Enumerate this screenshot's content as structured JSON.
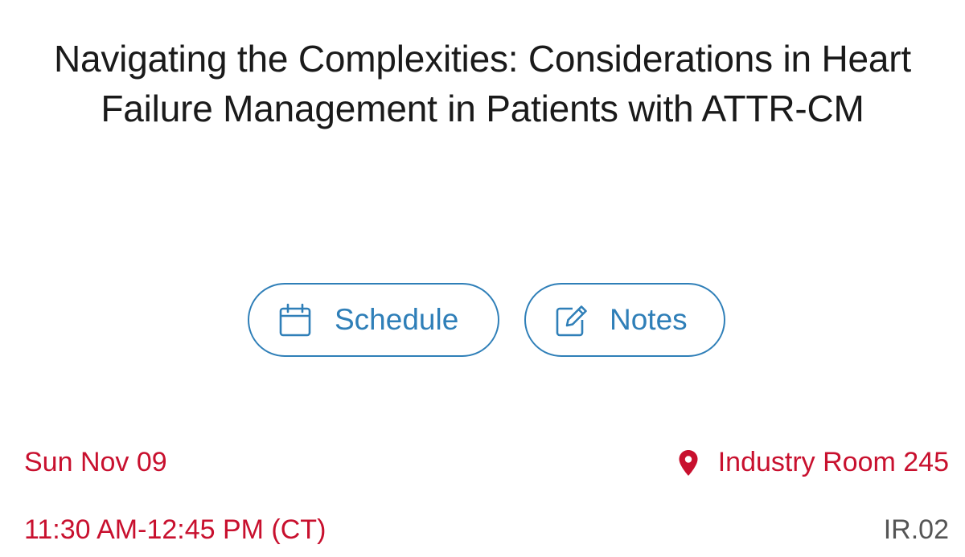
{
  "session": {
    "title": "Navigating the Complexities: Considerations in Heart Failure Management in Patients with ATTR-CM",
    "date": "Sun Nov 09",
    "time": "11:30 AM-12:45 PM (CT)",
    "location": "Industry Room 245",
    "code": "IR.02"
  },
  "actions": {
    "schedule_label": "Schedule",
    "schedule_icon": "calendar-icon",
    "notes_label": "Notes",
    "notes_icon": "edit-note-icon"
  },
  "colors": {
    "accent_blue": "#2f7fb8",
    "accent_red": "#c8102e",
    "code_gray": "#555555"
  }
}
